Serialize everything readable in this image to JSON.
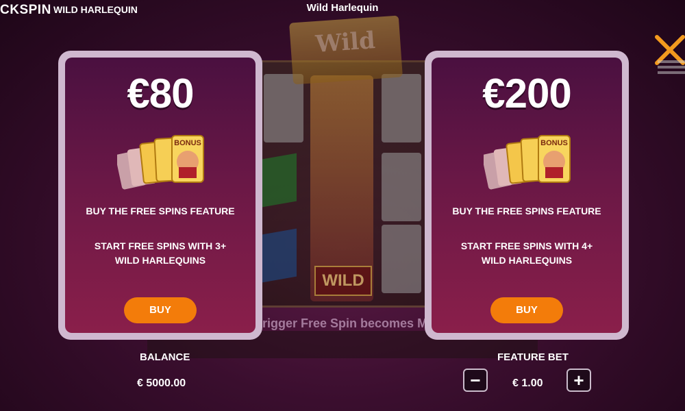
{
  "topbar": {
    "brand": "CKSPIN",
    "game_name": "WILD HARLEQUIN",
    "title": "Wild Harlequin"
  },
  "background": {
    "logo_text": "Wild",
    "wild_label": "WILD",
    "ticker": "rigger Free Spin becomes M"
  },
  "offers": [
    {
      "price": "€80",
      "title": "BUY THE FREE SPINS FEATURE",
      "description": "START FREE SPINS WITH 3+ WILD HARLEQUINS",
      "button": "BUY",
      "card_art": "bonus-cards-icon"
    },
    {
      "price": "€200",
      "title": "BUY THE FREE SPINS FEATURE",
      "description": "START FREE SPINS WITH 4+ WILD HARLEQUINS",
      "button": "BUY",
      "card_art": "bonus-cards-icon"
    }
  ],
  "footer": {
    "balance_label": "BALANCE",
    "balance_value": "€ 5000.00",
    "feature_bet_label": "FEATURE BET",
    "feature_bet_value": "€ 1.00",
    "decrease_symbol": "−",
    "increase_symbol": "+"
  },
  "colors": {
    "accent_button": "#f37c0a",
    "card_border": "#cfb8cf",
    "close_x": "#f39a1e"
  },
  "icons": [
    "close-icon",
    "menu-icon",
    "bonus-cards-icon",
    "minus-icon",
    "plus-icon"
  ]
}
